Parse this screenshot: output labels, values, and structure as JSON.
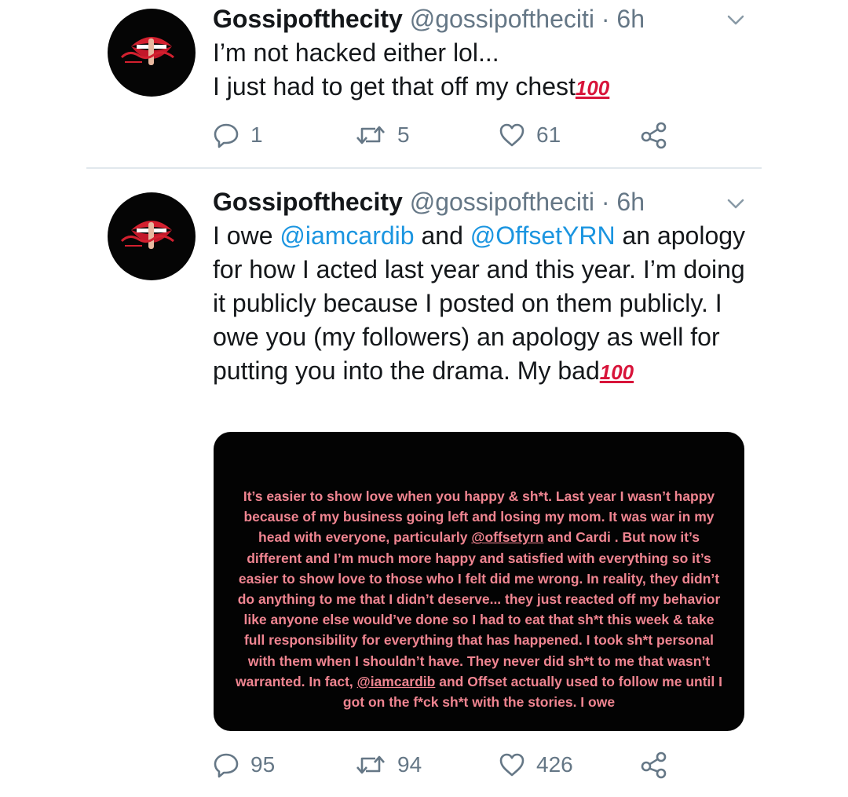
{
  "tweets": [
    {
      "name": "Gossipofthecity",
      "handle": "@gossipoftheciti",
      "separator": "·",
      "time": "6h",
      "body_line1": "I’m not hacked either lol...",
      "body_line2": "I just had to get that off my chest",
      "emoji": "100",
      "counts": {
        "replies": "1",
        "retweets": "5",
        "likes": "61"
      }
    },
    {
      "name": "Gossipofthecity",
      "handle": "@gossipoftheciti",
      "separator": "·",
      "time": "6h",
      "body_pre": "I owe ",
      "mention1": "@iamcardib",
      "body_mid": " and ",
      "mention2": "@OffsetYRN",
      "body_post": " an apology for how I acted last year and this year. I’m doing it publicly because I posted on them publicly. I owe you (my followers) an apology as well for putting you into the drama. My bad",
      "emoji": "100",
      "media": {
        "text_a": "It’s easier to show love when you happy & sh*t. Last year I wasn’t happy because of my business going left and losing my mom. It was war in my head with everyone, particularly ",
        "mention_a": "@offsetyrn",
        "text_b": " and Cardi . But now it’s different and I’m much more happy and satisfied with everything so it’s easier to show love to those who I felt did me wrong. In reality, they didn’t do anything to me that I didn’t deserve... they just reacted off my behavior like anyone else would’ve done so I had to eat that sh*t this week & take full responsibility for everything that has happened. I took sh*t personal with them when I shouldn’t have. They never did sh*t to me that wasn’t warranted. In fact, ",
        "mention_b": "@iamcardib",
        "text_c": " and Offset actually used to follow me until I got on the f*ck  sh*t with the stories. I owe"
      },
      "counts": {
        "replies": "95",
        "retweets": "94",
        "likes": "426"
      }
    }
  ],
  "colors": {
    "mention": "#1b95e0",
    "secondary": "#657786",
    "media_text": "#f08591",
    "divider": "#e1e8ed"
  },
  "icons": [
    "reply-icon",
    "retweet-icon",
    "like-icon",
    "share-icon",
    "chevron-down-icon"
  ]
}
